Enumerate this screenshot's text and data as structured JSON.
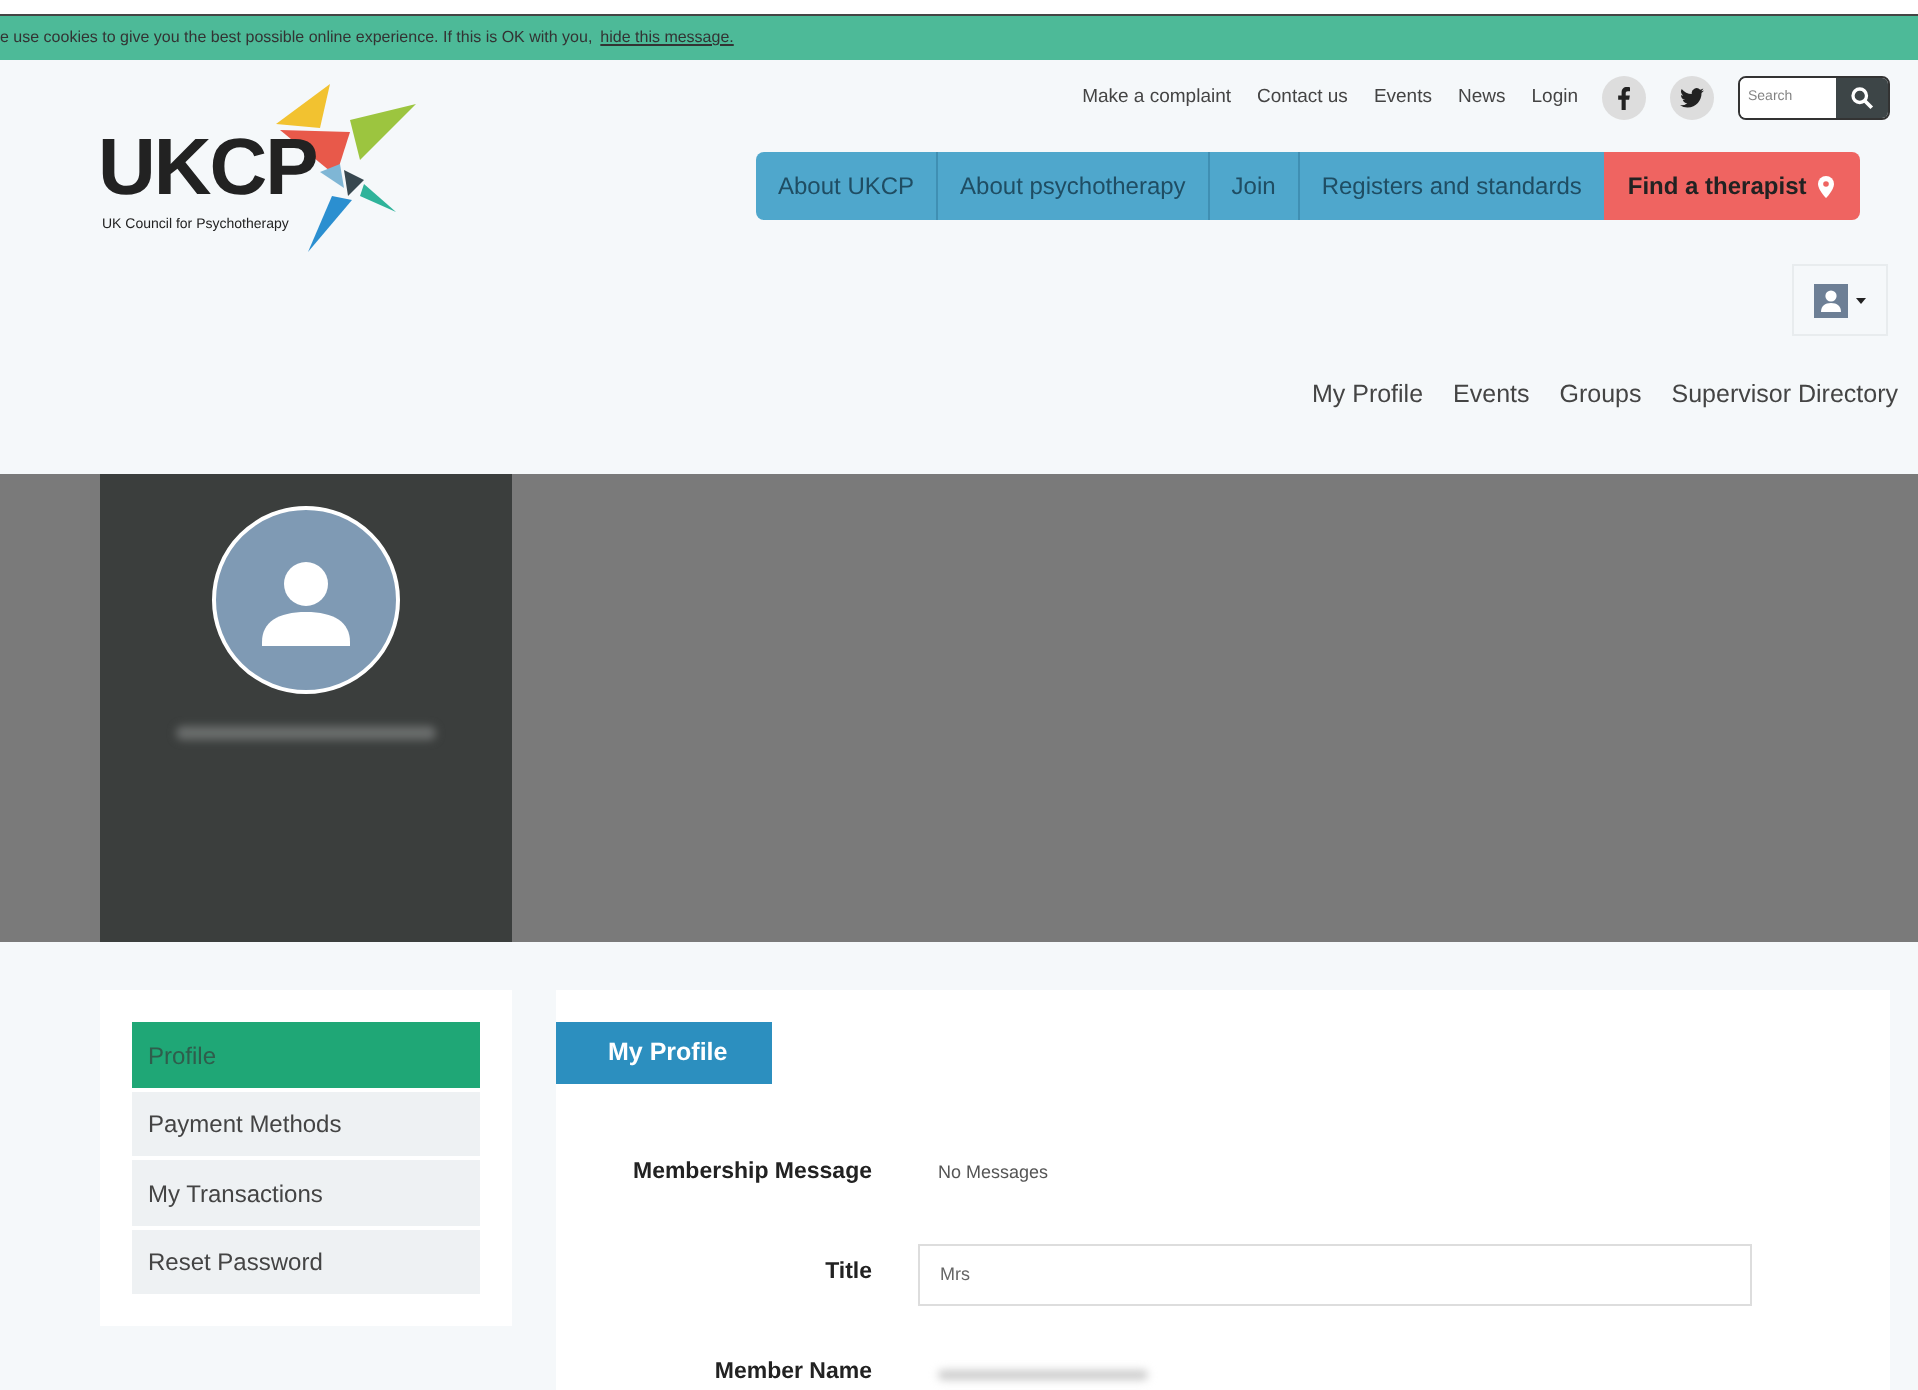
{
  "cookie_banner": {
    "text": "e use cookies to give you the best possible online experience. If this is OK with you,",
    "link": "hide this message."
  },
  "logo": {
    "wordmark": "UKCP",
    "tagline": "UK Council for Psychotherapy"
  },
  "top_links": [
    "Make a complaint",
    "Contact us",
    "Events",
    "News",
    "Login"
  ],
  "search": {
    "placeholder": "Search"
  },
  "main_nav": [
    {
      "label": "About UKCP",
      "kind": "plain"
    },
    {
      "label": "About psychotherapy",
      "kind": "plain"
    },
    {
      "label": "Join",
      "kind": "plain"
    },
    {
      "label": "Registers and standards",
      "kind": "plain"
    },
    {
      "label": "Find a therapist",
      "kind": "highlight"
    }
  ],
  "member_nav": [
    "My Profile",
    "Events",
    "Groups",
    "Supervisor Directory"
  ],
  "sidebar": {
    "items": [
      {
        "label": "Profile",
        "selected": true
      },
      {
        "label": "Payment Methods",
        "selected": false
      },
      {
        "label": "My Transactions",
        "selected": false
      },
      {
        "label": "Reset Password",
        "selected": false
      }
    ]
  },
  "panel": {
    "tab": "My Profile",
    "fields": [
      {
        "label": "Membership Message",
        "kind": "text",
        "value": "No Messages"
      },
      {
        "label": "Title",
        "kind": "input",
        "value": "Mrs"
      },
      {
        "label": "Member Name",
        "kind": "redacted"
      }
    ]
  }
}
